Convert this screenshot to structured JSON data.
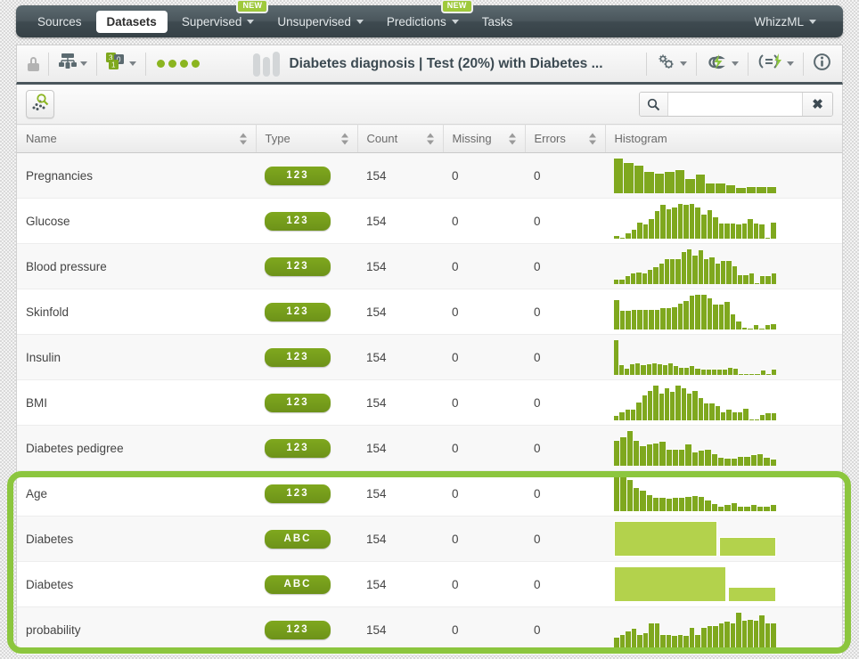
{
  "nav": {
    "items": [
      {
        "label": "Sources",
        "has_caret": false,
        "active": false,
        "badge": null
      },
      {
        "label": "Datasets",
        "has_caret": false,
        "active": true,
        "badge": null
      },
      {
        "label": "Supervised",
        "has_caret": true,
        "active": false,
        "badge": "NEW"
      },
      {
        "label": "Unsupervised",
        "has_caret": true,
        "active": false,
        "badge": null
      },
      {
        "label": "Predictions",
        "has_caret": true,
        "active": false,
        "badge": "NEW"
      },
      {
        "label": "Tasks",
        "has_caret": false,
        "active": false,
        "badge": null
      }
    ],
    "right": {
      "label": "WhizzML",
      "has_caret": true
    }
  },
  "titlebar": {
    "lock_icon": "lock-icon",
    "split_icon": "dataset-split-icon",
    "sample_icon": "sampling-icon",
    "status_dots": 4,
    "title": "Diabetes diagnosis | Test (20%) with Diabetes ...",
    "right_icons": [
      {
        "name": "gears-icon",
        "has_caret": true
      },
      {
        "name": "cloud-lightning-icon",
        "has_caret": true
      },
      {
        "name": "equals-lightning-icon",
        "has_caret": true
      },
      {
        "name": "info-icon",
        "has_caret": false
      }
    ]
  },
  "toolbar": {
    "scatter_button": "scatterplot-button",
    "search": {
      "value": "",
      "placeholder": ""
    },
    "clear_label": "✖"
  },
  "table": {
    "columns": [
      {
        "label": "Name",
        "sortable": true
      },
      {
        "label": "Type",
        "sortable": true
      },
      {
        "label": "Count",
        "sortable": true
      },
      {
        "label": "Missing",
        "sortable": true
      },
      {
        "label": "Errors",
        "sortable": true
      },
      {
        "label": "Histogram",
        "sortable": false
      }
    ],
    "rows": [
      {
        "name": "Pregnancies",
        "type": "123",
        "count": "154",
        "missing": "0",
        "errors": "0"
      },
      {
        "name": "Glucose",
        "type": "123",
        "count": "154",
        "missing": "0",
        "errors": "0"
      },
      {
        "name": "Blood pressure",
        "type": "123",
        "count": "154",
        "missing": "0",
        "errors": "0"
      },
      {
        "name": "Skinfold",
        "type": "123",
        "count": "154",
        "missing": "0",
        "errors": "0"
      },
      {
        "name": "Insulin",
        "type": "123",
        "count": "154",
        "missing": "0",
        "errors": "0"
      },
      {
        "name": "BMI",
        "type": "123",
        "count": "154",
        "missing": "0",
        "errors": "0"
      },
      {
        "name": "Diabetes pedigree",
        "type": "123",
        "count": "154",
        "missing": "0",
        "errors": "0"
      },
      {
        "name": "Age",
        "type": "123",
        "count": "154",
        "missing": "0",
        "errors": "0"
      },
      {
        "name": "Diabetes",
        "type": "ABC",
        "count": "154",
        "missing": "0",
        "errors": "0"
      },
      {
        "name": "Diabetes",
        "type": "ABC",
        "count": "154",
        "missing": "0",
        "errors": "0"
      },
      {
        "name": "probability",
        "type": "123",
        "count": "154",
        "missing": "0",
        "errors": "0"
      }
    ]
  },
  "colors": {
    "brand_green": "#7fa81e",
    "light_green": "#b3d24c",
    "highlight_ring": "#8cc63e",
    "navbar_dark": "#455157"
  },
  "chart_data": [
    {
      "type": "bar",
      "title": "Pregnancies",
      "kind": "numeric",
      "values": [
        40,
        35,
        32,
        25,
        23,
        25,
        27,
        17,
        22,
        12,
        12,
        10,
        7,
        8,
        8,
        8
      ],
      "ylim": [
        0,
        40
      ]
    },
    {
      "type": "bar",
      "title": "Glucose",
      "kind": "numeric",
      "values": [
        3,
        1,
        5,
        8,
        14,
        12,
        17,
        23,
        28,
        25,
        26,
        29,
        28,
        29,
        26,
        20,
        24,
        18,
        13,
        13,
        13,
        12,
        13,
        17,
        13,
        12,
        1,
        14
      ],
      "ylim": [
        0,
        29
      ]
    },
    {
      "type": "bar",
      "title": "Blood pressure",
      "kind": "numeric",
      "values": [
        4,
        4,
        7,
        9,
        10,
        9,
        12,
        14,
        17,
        20,
        20,
        20,
        26,
        28,
        23,
        27,
        20,
        22,
        17,
        19,
        19,
        15,
        8,
        8,
        9,
        1,
        7,
        7,
        9
      ],
      "ylim": [
        0,
        28
      ]
    },
    {
      "type": "bar",
      "title": "Skinfold",
      "kind": "numeric",
      "values": [
        25,
        16,
        16,
        17,
        17,
        17,
        17,
        17,
        18,
        18,
        19,
        22,
        24,
        28,
        29,
        29,
        26,
        21,
        21,
        23,
        13,
        7,
        2,
        1,
        4,
        1,
        4,
        5
      ],
      "ylim": [
        0,
        29
      ]
    },
    {
      "type": "bar",
      "title": "Insulin",
      "kind": "numeric",
      "values": [
        38,
        11,
        8,
        12,
        13,
        11,
        12,
        13,
        12,
        11,
        13,
        10,
        9,
        9,
        10,
        8,
        7,
        7,
        7,
        7,
        7,
        9,
        8,
        1,
        1,
        1,
        1,
        6,
        1,
        7
      ],
      "ylim": [
        0,
        38
      ]
    },
    {
      "type": "bar",
      "title": "BMI",
      "kind": "numeric",
      "values": [
        4,
        7,
        9,
        9,
        15,
        20,
        24,
        28,
        22,
        26,
        23,
        28,
        26,
        22,
        24,
        18,
        14,
        14,
        12,
        7,
        9,
        7,
        7,
        10,
        1,
        1,
        5,
        6,
        6
      ],
      "ylim": [
        0,
        28
      ]
    },
    {
      "type": "bar",
      "title": "Diabetes pedigree",
      "kind": "numeric",
      "values": [
        23,
        26,
        32,
        23,
        18,
        20,
        21,
        22,
        15,
        15,
        15,
        20,
        13,
        14,
        15,
        11,
        8,
        7,
        7,
        9,
        9,
        10,
        11,
        8,
        6
      ],
      "ylim": [
        0,
        32
      ]
    },
    {
      "type": "bar",
      "title": "Age",
      "kind": "numeric",
      "values": [
        37,
        37,
        33,
        25,
        22,
        18,
        15,
        15,
        14,
        15,
        15,
        16,
        17,
        16,
        12,
        8,
        6,
        7,
        9,
        6,
        6,
        7,
        6,
        6,
        7
      ],
      "ylim": [
        0,
        37
      ]
    },
    {
      "type": "bar",
      "title": "Diabetes",
      "kind": "categorical",
      "categories": [
        "false",
        "true"
      ],
      "values": [
        100,
        54
      ]
    },
    {
      "type": "bar",
      "title": "Diabetes (predicted)",
      "kind": "categorical",
      "categories": [
        "false",
        "true"
      ],
      "values": [
        100,
        42
      ]
    },
    {
      "type": "bar",
      "title": "probability",
      "kind": "numeric",
      "values": [
        9,
        12,
        15,
        17,
        12,
        13,
        22,
        22,
        12,
        12,
        11,
        12,
        11,
        18,
        12,
        18,
        19,
        19,
        22,
        23,
        22,
        31,
        24,
        25,
        24,
        29,
        22,
        22
      ],
      "ylim": [
        0,
        31
      ]
    }
  ]
}
